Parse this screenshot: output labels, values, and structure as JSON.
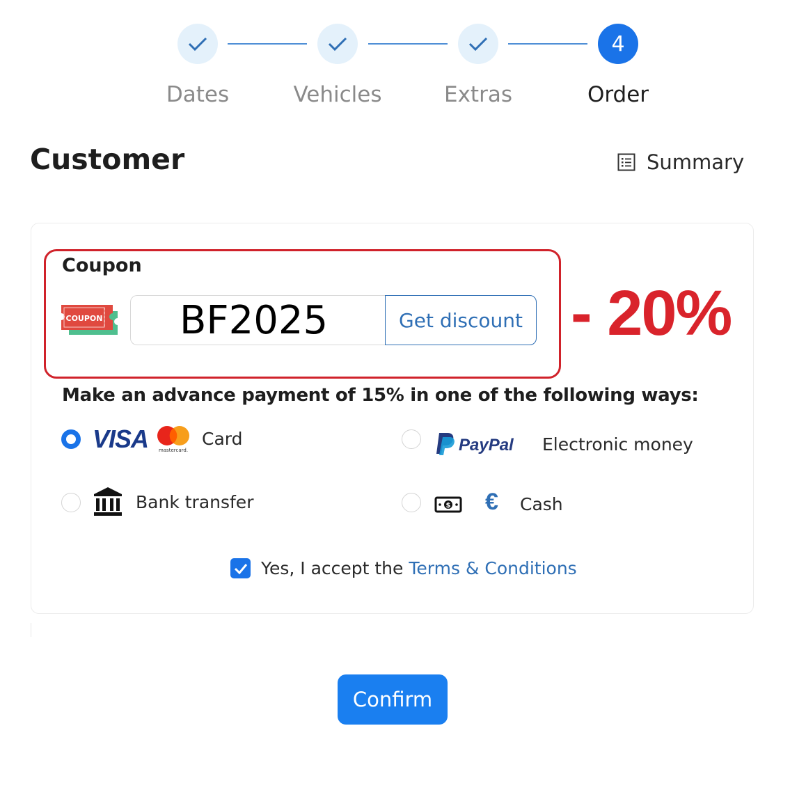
{
  "stepper": {
    "steps": [
      {
        "label": "Dates",
        "state": "done",
        "icon": "check-icon"
      },
      {
        "label": "Vehicles",
        "state": "done",
        "icon": "check-icon"
      },
      {
        "label": "Extras",
        "state": "done",
        "icon": "check-icon"
      },
      {
        "label": "Order",
        "state": "active",
        "number": "4"
      }
    ]
  },
  "header": {
    "title": "Customer",
    "summary_label": "Summary",
    "summary_icon": "list-icon"
  },
  "coupon": {
    "title": "Coupon",
    "icon_text": "COUPON",
    "value": "BF2025",
    "button_label": "Get discount",
    "discount": "- 20%"
  },
  "payment": {
    "heading": "Make an advance payment of 15% in one of the following ways:",
    "options": [
      {
        "label": "Card",
        "selected": true,
        "icons": [
          "VISA",
          "mastercard"
        ]
      },
      {
        "label": "Electronic money",
        "selected": false,
        "icons": [
          "PayPal"
        ]
      },
      {
        "label": "Bank transfer",
        "selected": false,
        "icons": [
          "bank-icon"
        ]
      },
      {
        "label": "Cash",
        "selected": false,
        "icons": [
          "banknote-icon",
          "€"
        ]
      }
    ],
    "visa_text": "VISA",
    "mastercard_text": "mastercard.",
    "paypal_text": "PayPal",
    "euro_symbol": "€"
  },
  "terms": {
    "checked": true,
    "prefix": "Yes, I accept the",
    "link": "Terms & Conditions"
  },
  "confirm_label": "Confirm",
  "colors": {
    "primary": "#1a73e8",
    "link": "#2f6fb5",
    "step_done_bg": "#e4f1fb",
    "highlight_red": "#d9232b"
  }
}
